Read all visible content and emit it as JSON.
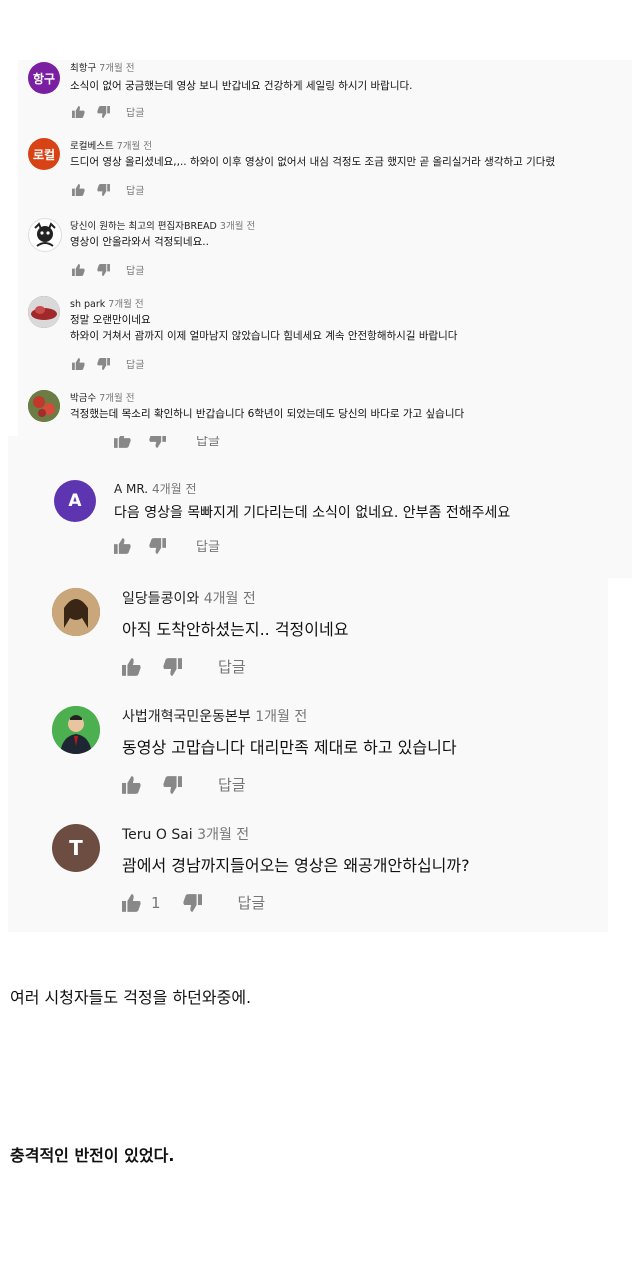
{
  "reply_label": "답글",
  "comments_small": [
    {
      "avatar_text": "항구",
      "avatar_color": "#7b1fa2",
      "author": "최항구",
      "time": "7개월 전",
      "lines": [
        "소식이 없어 궁금했는데 영상 보니 반갑네요 건강하게 세일링 하시기 바랍니다."
      ]
    },
    {
      "avatar_text": "로컬",
      "avatar_color": "#d84315",
      "author": "로컬베스트",
      "time": "7개월 전",
      "lines": [
        "드디어 영상 올리셨네요,,.. 하와이 이후 영상이 없어서 내심 걱정도 조금 했지만 곧 올리실거라 생각하고 기다렸"
      ]
    },
    {
      "avatar_text": "",
      "avatar_color": "#ffffff",
      "author": "당신이 원하는 최고의 편집자BREAD",
      "time": "3개월 전",
      "lines": [
        "영상이 안올라와서 걱정되네요.."
      ]
    },
    {
      "avatar_text": "",
      "avatar_color": "#8d3b3b",
      "author": "sh park",
      "time": "7개월 전",
      "lines": [
        "정말 오랜만이네요",
        "하와이 거쳐서 괌까지 이제 얼마남지 않았습니다 힘네세요 계속 안전항해하시길 바랍니다"
      ]
    },
    {
      "avatar_text": "",
      "avatar_color": "#5a6b3a",
      "author": "박금수",
      "time": "7개월 전",
      "lines": [
        "걱정했는데 목소리 확인하니 반갑습니다 6학년이 되었는데도 당신의 바다로 가고 싶습니다"
      ]
    }
  ],
  "comment_medium": {
    "avatar_text": "A",
    "avatar_color": "#5e35b1",
    "author": "A MR.",
    "time": "4개월 전",
    "text": "다음 영상을 목빠지게 기다리는데 소식이 없네요. 안부좀 전해주세요"
  },
  "comments_large": [
    {
      "avatar_text": "",
      "avatar_color": "#7a5a3a",
      "author": "일당들콩이와",
      "time": "4개월 전",
      "text": "아직 도착안하셨는지.. 걱정이네요",
      "likes": ""
    },
    {
      "avatar_text": "",
      "avatar_color": "#4caf50",
      "author": "사법개혁국민운동본부",
      "time": "1개월 전",
      "text": "동영상 고맙습니다 대리만족 제대로 하고 있습니다",
      "likes": ""
    },
    {
      "avatar_text": "T",
      "avatar_color": "#6d4c41",
      "author": "Teru O Sai",
      "time": "3개월 전",
      "text": "괌에서 경남까지들어오는 영상은 왜공개안하십니까?",
      "likes": "1"
    }
  ],
  "caption1": "여러 시청자들도 걱정을 하던와중에.",
  "caption2": "충격적인 반전이 있었다."
}
